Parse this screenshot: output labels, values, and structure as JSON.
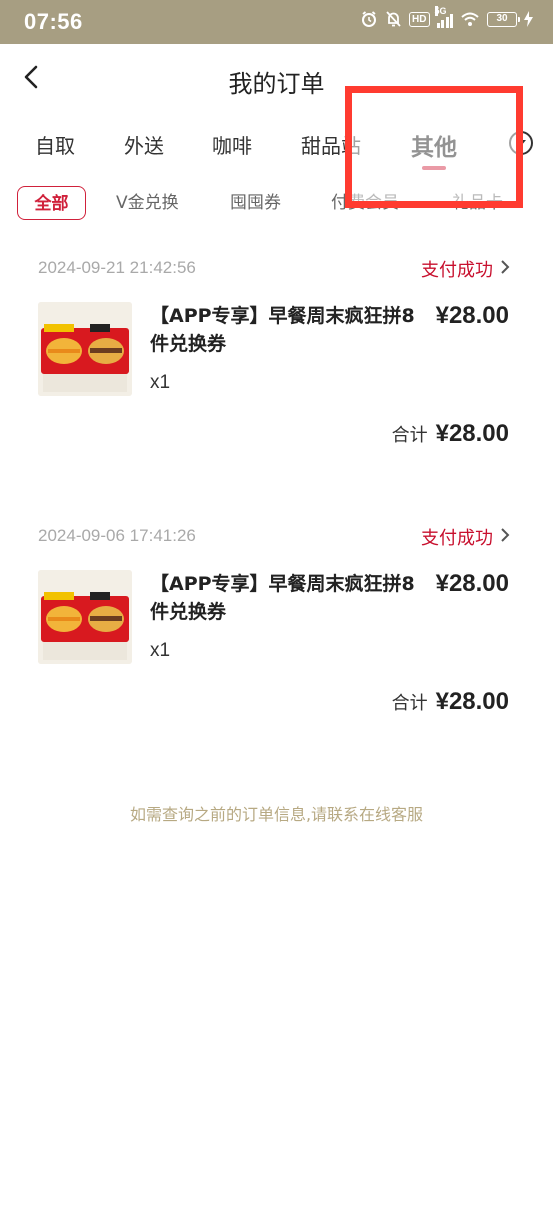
{
  "status_bar": {
    "time": "07:56",
    "hd": "HD",
    "network": "5G",
    "battery": "30"
  },
  "header": {
    "title": "我的订单"
  },
  "category_tabs": [
    "自取",
    "外送",
    "咖啡",
    "甜品站",
    "其他"
  ],
  "active_category": "其他",
  "sub_tabs": [
    "全部",
    "V金兑换",
    "囤囤券",
    "付费会员",
    "礼品卡"
  ],
  "active_sub_tab": "全部",
  "orders": [
    {
      "date": "2024-09-21 21:42:56",
      "status": "支付成功",
      "name": "【APP专享】早餐周末疯狂拼8件兑换券",
      "price": "¥28.00",
      "qty": "x1",
      "total_label": "合计",
      "total": "¥28.00"
    },
    {
      "date": "2024-09-06 17:41:26",
      "status": "支付成功",
      "name": "【APP专享】早餐周末疯狂拼8件兑换券",
      "price": "¥28.00",
      "qty": "x1",
      "total_label": "合计",
      "total": "¥28.00"
    }
  ],
  "footer_note": "如需查询之前的订单信息,请联系在线客服",
  "colors": {
    "status_bar": "#a79e82",
    "accent_red": "#d0213b",
    "highlight": "#ff3b30",
    "footer_text": "#b7a983"
  },
  "icons": [
    "back-icon",
    "alarm-icon",
    "mute-icon",
    "wifi-icon",
    "battery-icon",
    "charging-icon",
    "chevron-right-icon",
    "dropdown-icon"
  ]
}
